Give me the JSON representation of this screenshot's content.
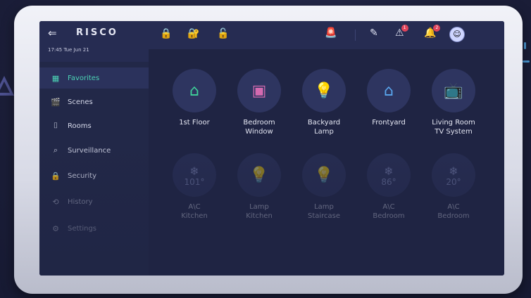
{
  "header": {
    "brand": "RISCO",
    "datetime": "17:45  Tue Jun 21",
    "alerts_count": "1",
    "notifications_count": "2"
  },
  "icons": {
    "back": "back-arrow-icon",
    "locks": [
      "lock-red-icon",
      "lock-red-partial-icon",
      "lock-green-icon"
    ],
    "siren": "siren-icon",
    "edit": "pencil-icon",
    "alert": "warning-icon",
    "bell": "bell-icon",
    "avatar": "avatar-icon"
  },
  "colors": {
    "accent": "#4cd3b5",
    "lock_red": "#e0445b",
    "lock_green": "#3fd29a",
    "badge": "#e0445b",
    "tv_orange": "#e0743a"
  },
  "sidebar": {
    "items": [
      {
        "label": "Favorites"
      },
      {
        "label": "Scenes"
      },
      {
        "label": "Rooms"
      },
      {
        "label": "Surveillance"
      },
      {
        "label": "Security"
      },
      {
        "label": "History"
      },
      {
        "label": "Settings"
      }
    ]
  },
  "tiles": [
    {
      "label": "1st Floor"
    },
    {
      "label": "Bedroom\nWindow"
    },
    {
      "label": "Backyard\nLamp"
    },
    {
      "label": "Frontyard"
    },
    {
      "label": "Living Room\nTV System"
    },
    {
      "label": "A\\C\nKitchen",
      "temp": "101°"
    },
    {
      "label": "Lamp\nKitchen"
    },
    {
      "label": "Lamp\nStaircase"
    },
    {
      "label": "A\\C\nBedroom",
      "temp": "86°"
    },
    {
      "label": "A\\C\nBedroom",
      "temp": "20°"
    }
  ]
}
